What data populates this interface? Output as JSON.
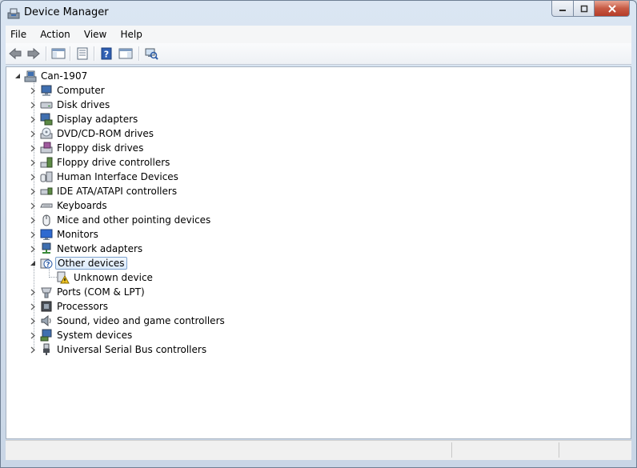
{
  "window": {
    "title": "Device Manager"
  },
  "menu": [
    "File",
    "Action",
    "View",
    "Help"
  ],
  "toolbar": {
    "buttons": [
      {
        "name": "back-icon"
      },
      {
        "name": "forward-icon"
      },
      {
        "name": "show-hide-console-tree-icon"
      },
      {
        "name": "properties-icon"
      },
      {
        "name": "help-icon"
      },
      {
        "name": "show-action-pane-icon"
      },
      {
        "name": "scan-hardware-changes-icon"
      }
    ]
  },
  "tree": {
    "root": {
      "label": "Can-1907",
      "icon": "computer-root-icon",
      "expanded": true
    },
    "categories": [
      {
        "label": "Computer",
        "icon": "computer-icon"
      },
      {
        "label": "Disk drives",
        "icon": "disk-drive-icon"
      },
      {
        "label": "Display adapters",
        "icon": "display-adapter-icon"
      },
      {
        "label": "DVD/CD-ROM drives",
        "icon": "dvd-drive-icon"
      },
      {
        "label": "Floppy disk drives",
        "icon": "floppy-disk-icon"
      },
      {
        "label": "Floppy drive controllers",
        "icon": "floppy-controller-icon"
      },
      {
        "label": "Human Interface Devices",
        "icon": "hid-icon"
      },
      {
        "label": "IDE ATA/ATAPI controllers",
        "icon": "ide-controller-icon"
      },
      {
        "label": "Keyboards",
        "icon": "keyboard-icon"
      },
      {
        "label": "Mice and other pointing devices",
        "icon": "mouse-icon"
      },
      {
        "label": "Monitors",
        "icon": "monitor-icon"
      },
      {
        "label": "Network adapters",
        "icon": "network-adapter-icon"
      },
      {
        "label": "Other devices",
        "icon": "other-devices-icon",
        "expanded": true,
        "selected": true,
        "children": [
          {
            "label": "Unknown device",
            "icon": "unknown-device-warning-icon"
          }
        ]
      },
      {
        "label": "Ports (COM & LPT)",
        "icon": "ports-icon"
      },
      {
        "label": "Processors",
        "icon": "processor-icon"
      },
      {
        "label": "Sound, video and game controllers",
        "icon": "sound-icon"
      },
      {
        "label": "System devices",
        "icon": "system-devices-icon"
      },
      {
        "label": "Universal Serial Bus controllers",
        "icon": "usb-icon"
      }
    ]
  }
}
